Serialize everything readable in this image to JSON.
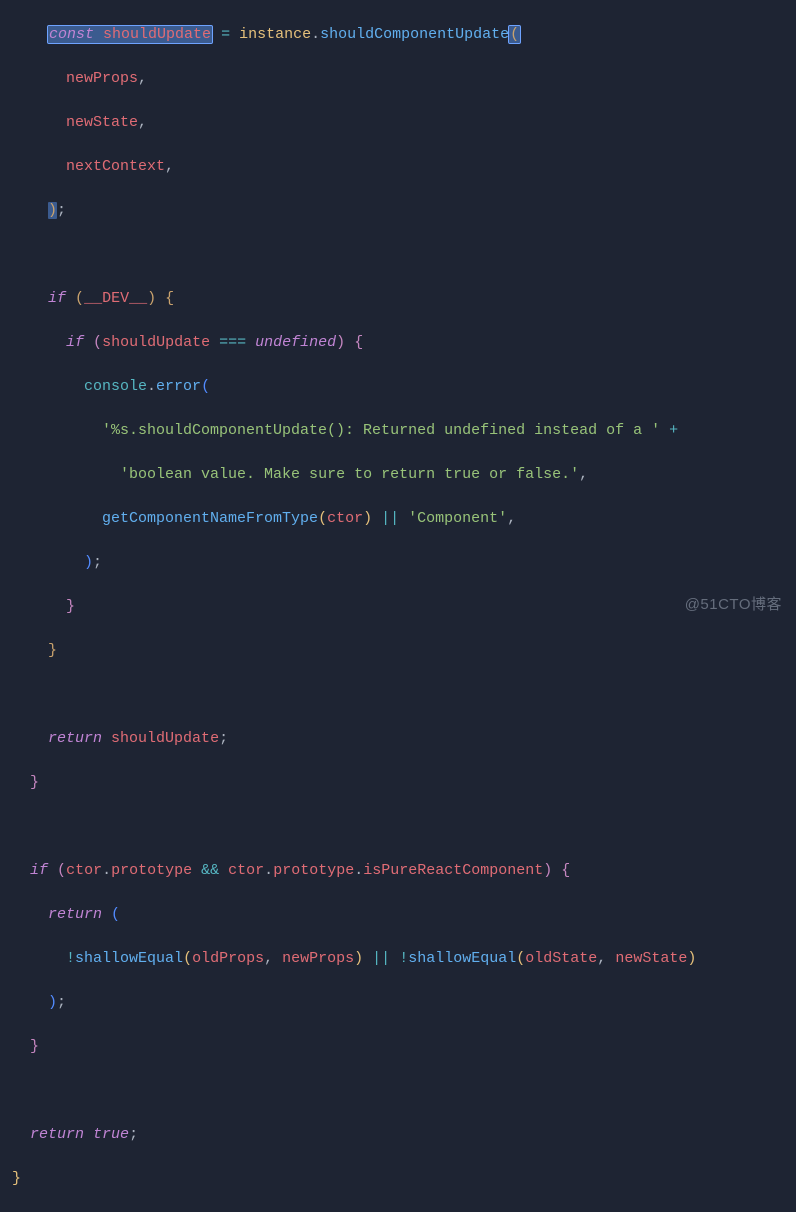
{
  "code": {
    "l1_const": "const",
    "l1_var": " shouldUpdate",
    "l1_eq": " = ",
    "l1_inst": "instance",
    "l1_dot": ".",
    "l1_method": "shouldComponentUpdate",
    "l1_op": "(",
    "l2": "newProps",
    "l3": "newState",
    "l4": "nextContext",
    "l5_cp": ")",
    "l5_sc": ";",
    "if": "if",
    "dev": "__DEV__",
    "shouldUpdate": "shouldUpdate",
    "tripleEq": "===",
    "undef": "undefined",
    "console": "console",
    "error": "error",
    "str1a": "'%s.shouldComponentUpdate(): Returned undefined instead of a '",
    "str1p": " +",
    "str1b": "'boolean value. Make sure to return true or false.'",
    "getComp": "getComponentNameFromType",
    "ctor": "ctor",
    "or": "||",
    "compStr": "'Component'",
    "return": "return",
    "ret_su": "shouldUpdate",
    "proto": "prototype",
    "and": "&&",
    "isPure": "isPureReactComponent",
    "not": "!",
    "shallowEq": "shallowEqual",
    "oldProps": "oldProps",
    "newProps": "newProps",
    "oldState": "oldState",
    "newState": "newState",
    "true": "true",
    "comma": ",",
    "dot": ".",
    "open_p": "(",
    "close_p": ")",
    "open_b": "{",
    "close_b": "}",
    "semi": ";"
  },
  "watermark": "@51CTO博客"
}
